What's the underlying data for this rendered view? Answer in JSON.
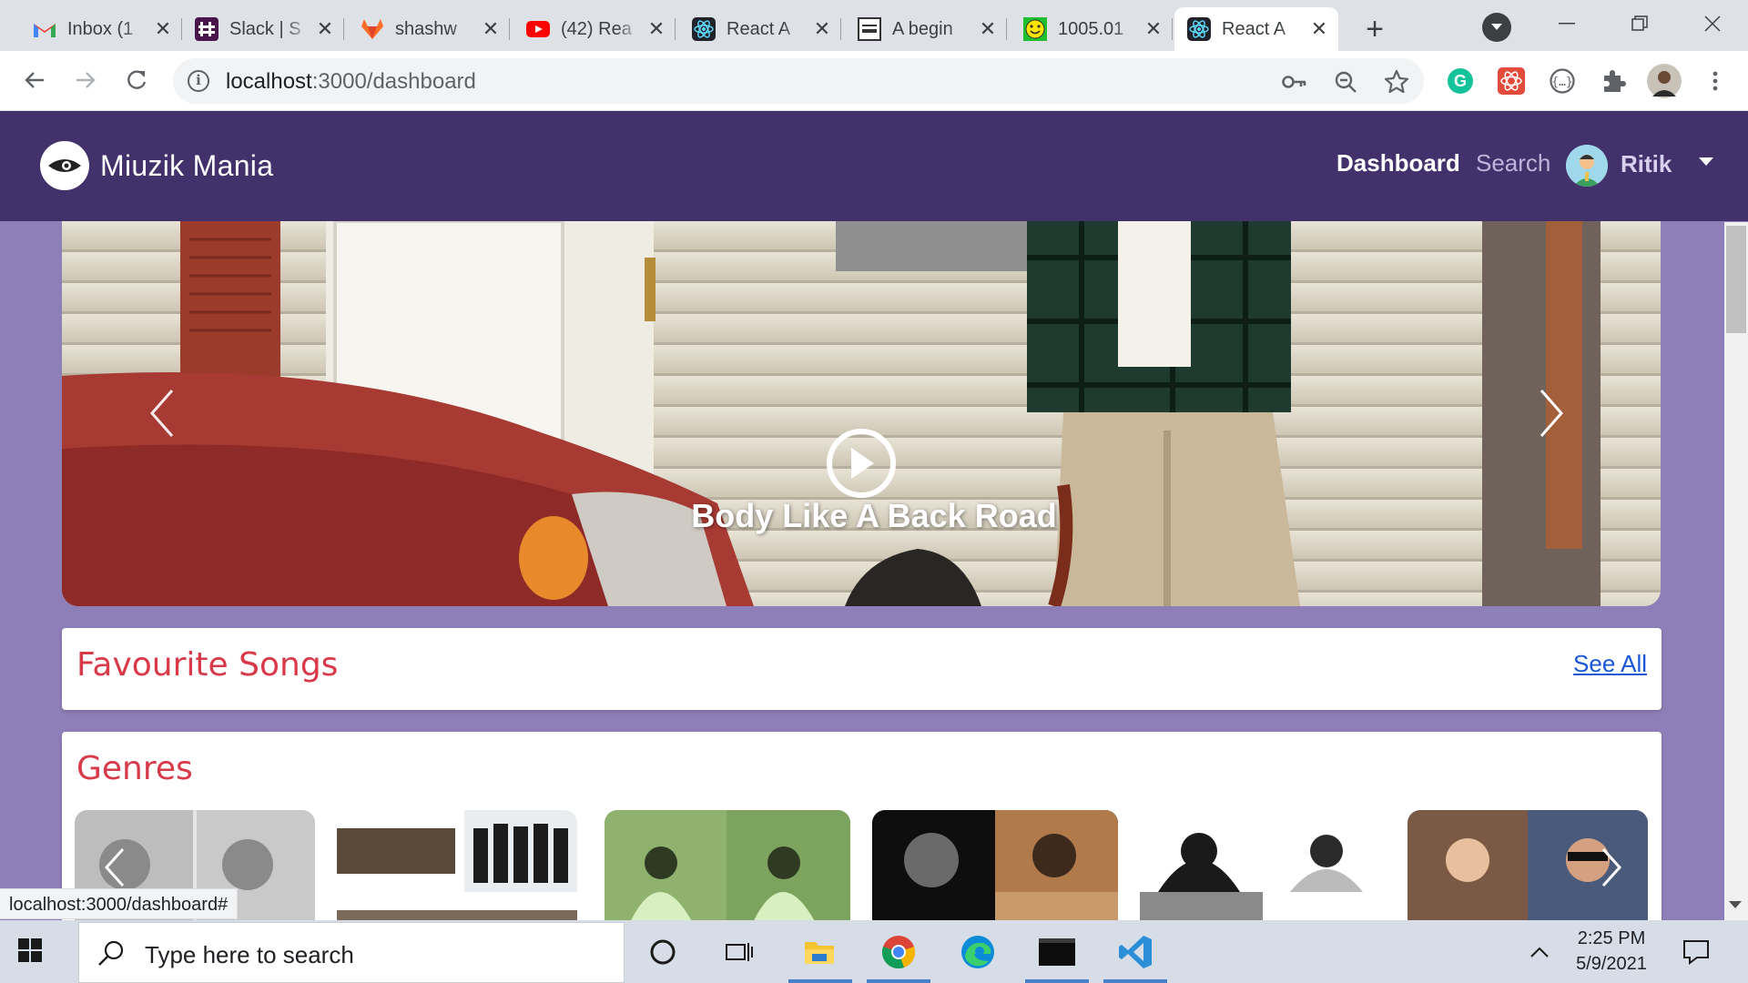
{
  "browser": {
    "tabs": [
      {
        "title": "Inbox (1",
        "icon": "gmail-icon"
      },
      {
        "title": "Slack | S",
        "icon": "slack-icon"
      },
      {
        "title": "shashw",
        "icon": "gitlab-icon"
      },
      {
        "title": "(42) Rea",
        "icon": "youtube-icon"
      },
      {
        "title": "React A",
        "icon": "react-icon"
      },
      {
        "title": "A begin",
        "icon": "writethedocs-icon"
      },
      {
        "title": "1005.01",
        "icon": "smiley-icon"
      },
      {
        "title": "React A",
        "icon": "react-icon",
        "active": true
      }
    ],
    "url_host": "localhost",
    "url_path": ":3000/dashboard"
  },
  "app": {
    "brand": "Miuzik Mania",
    "nav": {
      "dashboard": "Dashboard",
      "search": "Search",
      "user": "Ritik"
    },
    "carousel": {
      "caption": "Body Like A Back Road"
    },
    "favourites": {
      "title": "Favourite Songs",
      "see_all": "See All"
    },
    "genres": {
      "title": "Genres"
    }
  },
  "status_bar": {
    "link": "localhost:3000/dashboard#"
  },
  "taskbar": {
    "search_placeholder": "Type here to search",
    "time": "2:25 PM",
    "date": "5/9/2021"
  },
  "colors": {
    "nav_bg": "#42316b",
    "page_bg": "#8e7fb8",
    "card_title": "#d83a4a",
    "link": "#1a56d6"
  }
}
